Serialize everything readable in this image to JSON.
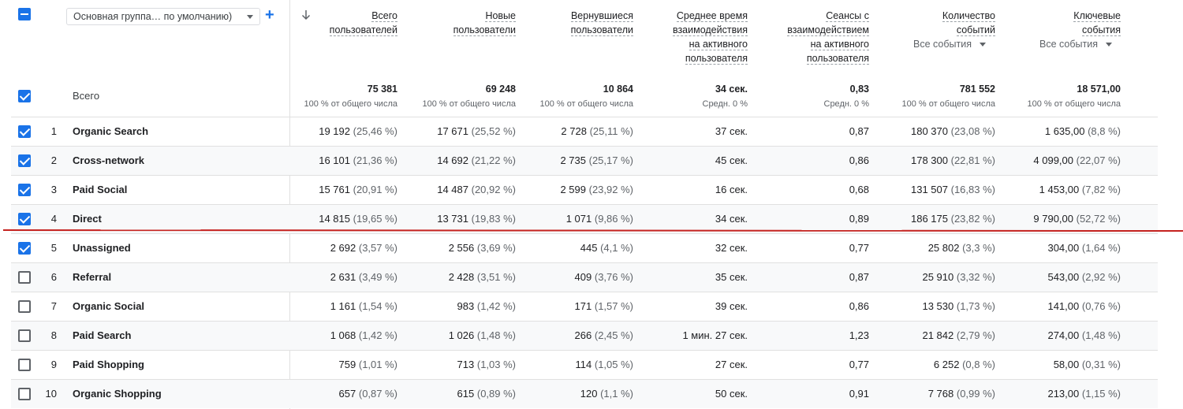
{
  "dimension_dropdown": {
    "value": "Основная группа… по умолчанию)"
  },
  "add_dimension_label": "+",
  "sort_icon": "arrow-down-icon",
  "columns": [
    {
      "lines": [
        "Всего",
        "пользователей"
      ],
      "total": "75 381",
      "total_sub": "100 % от общего числа"
    },
    {
      "lines": [
        "Новые",
        "пользователи"
      ],
      "total": "69 248",
      "total_sub": "100 % от общего числа"
    },
    {
      "lines": [
        "Вернувшиеся",
        "пользователи"
      ],
      "total": "10 864",
      "total_sub": "100 % от общего числа"
    },
    {
      "lines": [
        "Среднее время",
        "взаимодействия",
        "на активного",
        "пользователя"
      ],
      "total": "34 сек.",
      "total_sub": "Средн. 0 %"
    },
    {
      "lines": [
        "Сеансы с",
        "взаимодействием",
        "на активного",
        "пользователя"
      ],
      "total": "0,83",
      "total_sub": "Средн. 0 %"
    },
    {
      "lines": [
        "Количество",
        "событий"
      ],
      "select": "Все события",
      "total": "781 552",
      "total_sub": "100 % от общего числа"
    },
    {
      "lines": [
        "Ключевые",
        "события"
      ],
      "select": "Все события",
      "total": "18 571,00",
      "total_sub": "100 % от общего числа"
    }
  ],
  "totals_label": "Всего",
  "rows": [
    {
      "idx": "1",
      "name": "Organic Search",
      "checked": true,
      "cells": [
        [
          "19 192",
          "(25,46 %)"
        ],
        [
          "17 671",
          "(25,52 %)"
        ],
        [
          "2 728",
          "(25,11 %)"
        ],
        [
          "37 сек.",
          ""
        ],
        [
          "0,87",
          ""
        ],
        [
          "180 370",
          "(23,08 %)"
        ],
        [
          "1 635,00",
          "(8,8 %)"
        ]
      ]
    },
    {
      "idx": "2",
      "name": "Cross-network",
      "checked": true,
      "cells": [
        [
          "16 101",
          "(21,36 %)"
        ],
        [
          "14 692",
          "(21,22 %)"
        ],
        [
          "2 735",
          "(25,17 %)"
        ],
        [
          "45 сек.",
          ""
        ],
        [
          "0,86",
          ""
        ],
        [
          "178 300",
          "(22,81 %)"
        ],
        [
          "4 099,00",
          "(22,07 %)"
        ]
      ]
    },
    {
      "idx": "3",
      "name": "Paid Social",
      "checked": true,
      "cells": [
        [
          "15 761",
          "(20,91 %)"
        ],
        [
          "14 487",
          "(20,92 %)"
        ],
        [
          "2 599",
          "(23,92 %)"
        ],
        [
          "16 сек.",
          ""
        ],
        [
          "0,68",
          ""
        ],
        [
          "131 507",
          "(16,83 %)"
        ],
        [
          "1 453,00",
          "(7,82 %)"
        ]
      ]
    },
    {
      "idx": "4",
      "name": "Direct",
      "checked": true,
      "cells": [
        [
          "14 815",
          "(19,65 %)"
        ],
        [
          "13 731",
          "(19,83 %)"
        ],
        [
          "1 071",
          "(9,86 %)"
        ],
        [
          "34 сек.",
          ""
        ],
        [
          "0,89",
          ""
        ],
        [
          "186 175",
          "(23,82 %)"
        ],
        [
          "9 790,00",
          "(52,72 %)"
        ]
      ]
    },
    {
      "idx": "5",
      "name": "Unassigned",
      "checked": true,
      "cells": [
        [
          "2 692",
          "(3,57 %)"
        ],
        [
          "2 556",
          "(3,69 %)"
        ],
        [
          "445",
          "(4,1 %)"
        ],
        [
          "32 сек.",
          ""
        ],
        [
          "0,77",
          ""
        ],
        [
          "25 802",
          "(3,3 %)"
        ],
        [
          "304,00",
          "(1,64 %)"
        ]
      ]
    },
    {
      "idx": "6",
      "name": "Referral",
      "checked": false,
      "cells": [
        [
          "2 631",
          "(3,49 %)"
        ],
        [
          "2 428",
          "(3,51 %)"
        ],
        [
          "409",
          "(3,76 %)"
        ],
        [
          "35 сек.",
          ""
        ],
        [
          "0,87",
          ""
        ],
        [
          "25 910",
          "(3,32 %)"
        ],
        [
          "543,00",
          "(2,92 %)"
        ]
      ]
    },
    {
      "idx": "7",
      "name": "Organic Social",
      "checked": false,
      "cells": [
        [
          "1 161",
          "(1,54 %)"
        ],
        [
          "983",
          "(1,42 %)"
        ],
        [
          "171",
          "(1,57 %)"
        ],
        [
          "39 сек.",
          ""
        ],
        [
          "0,86",
          ""
        ],
        [
          "13 530",
          "(1,73 %)"
        ],
        [
          "141,00",
          "(0,76 %)"
        ]
      ]
    },
    {
      "idx": "8",
      "name": "Paid Search",
      "checked": false,
      "cells": [
        [
          "1 068",
          "(1,42 %)"
        ],
        [
          "1 026",
          "(1,48 %)"
        ],
        [
          "266",
          "(2,45 %)"
        ],
        [
          "1 мин. 27 сек.",
          ""
        ],
        [
          "1,23",
          ""
        ],
        [
          "21 842",
          "(2,79 %)"
        ],
        [
          "274,00",
          "(1,48 %)"
        ]
      ]
    },
    {
      "idx": "9",
      "name": "Paid Shopping",
      "checked": false,
      "cells": [
        [
          "759",
          "(1,01 %)"
        ],
        [
          "713",
          "(1,03 %)"
        ],
        [
          "114",
          "(1,05 %)"
        ],
        [
          "27 сек.",
          ""
        ],
        [
          "0,77",
          ""
        ],
        [
          "6 252",
          "(0,8 %)"
        ],
        [
          "58,00",
          "(0,31 %)"
        ]
      ]
    },
    {
      "idx": "10",
      "name": "Organic Shopping",
      "checked": false,
      "cells": [
        [
          "657",
          "(0,87 %)"
        ],
        [
          "615",
          "(0,89 %)"
        ],
        [
          "120",
          "(1,1 %)"
        ],
        [
          "50 сек.",
          ""
        ],
        [
          "0,91",
          ""
        ],
        [
          "7 768",
          "(0,99 %)"
        ],
        [
          "213,00",
          "(1,15 %)"
        ]
      ]
    }
  ],
  "annotation_color": "#c5221f",
  "accent_color": "#1a73e8"
}
